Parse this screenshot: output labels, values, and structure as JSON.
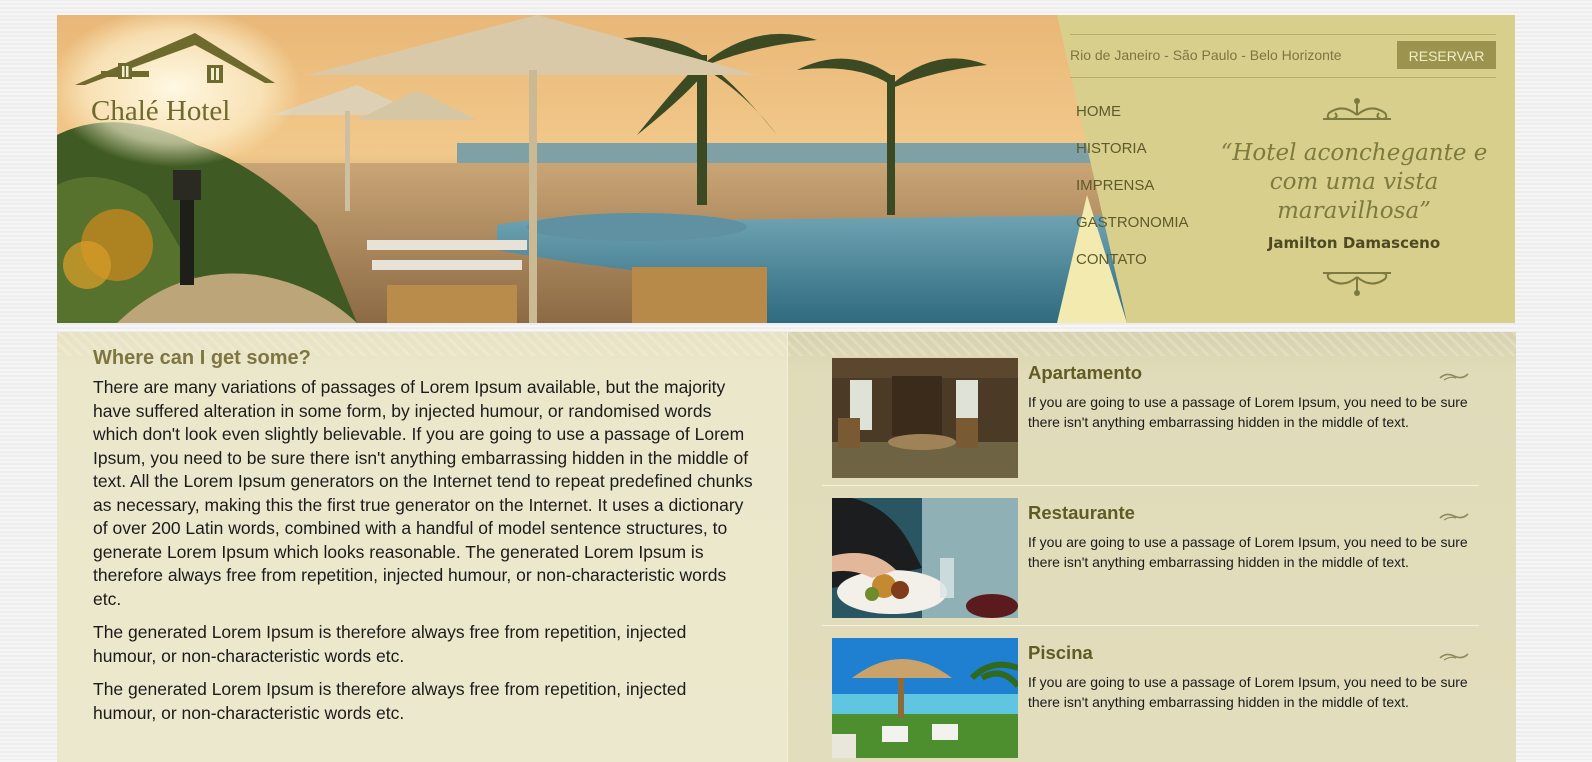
{
  "brand": {
    "name": "Chalé Hotel"
  },
  "topbar": {
    "cities": "Rio de Janeiro - São Paulo - Belo Horizonte",
    "reserve_label": "RESERVAR"
  },
  "nav": {
    "items": [
      {
        "label": "HOME"
      },
      {
        "label": "HISTORIA"
      },
      {
        "label": "IMPRENSA"
      },
      {
        "label": "GASTRONOMIA"
      },
      {
        "label": "CONTATO"
      }
    ]
  },
  "quote": {
    "text": "“Hotel aconchegante e com uma vista maravilhosa”",
    "author": "Jamilton Damasceno"
  },
  "article": {
    "title": "Where can I get some?",
    "paragraphs": [
      "There are many variations of passages of Lorem Ipsum available, but the majority have suffered alteration in some form, by injected humour, or randomised words which don't look even slightly believable. If you are going to use a passage of Lorem Ipsum, you need to be sure there isn't anything embarrassing hidden in the middle of text. All the Lorem Ipsum generators on the Internet tend to repeat predefined chunks as necessary, making this the first true generator on the Internet. It uses a dictionary of over 200 Latin words, combined with a handful of model sentence structures, to generate Lorem Ipsum which looks reasonable. The generated Lorem Ipsum is therefore always free from repetition, injected humour, or non-characteristic words etc.",
      "The generated Lorem Ipsum is therefore always free from repetition, injected humour, or non-characteristic words etc.",
      "The generated Lorem Ipsum is therefore always free from repetition, injected humour, or non-characteristic words etc."
    ]
  },
  "cards": [
    {
      "title": "Apartamento",
      "text": "If you are going to use a passage of Lorem Ipsum, you need to be sure there isn't anything embarrassing hidden in the middle of text."
    },
    {
      "title": "Restaurante",
      "text": "If you are going to use a passage of Lorem Ipsum, you need to be sure there isn't anything embarrassing hidden in the middle of text."
    },
    {
      "title": "Piscina",
      "text": "If you are going to use a passage of Lorem Ipsum, you need to be sure there isn't anything embarrassing hidden in the middle of text."
    }
  ],
  "colors": {
    "header_panel": "#d8cf8c",
    "brand_olive": "#7d7640",
    "button_bg": "#9c944e",
    "left_col_bg": "#ece8cd",
    "right_col_bg": "#e2ddbc"
  }
}
